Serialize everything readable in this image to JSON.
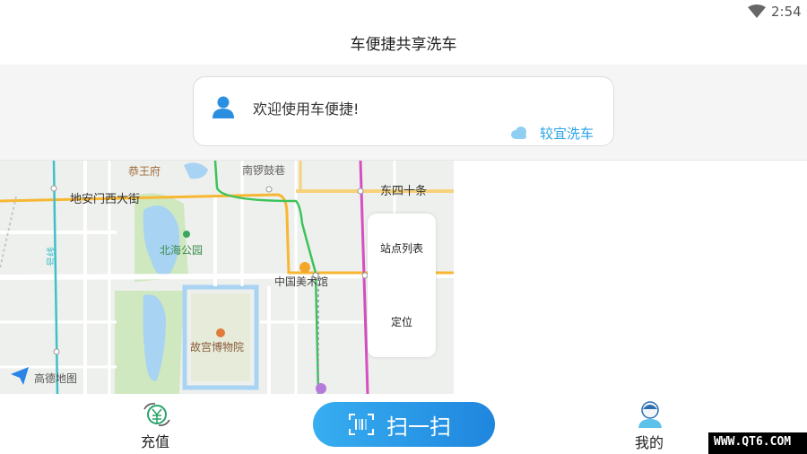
{
  "status_bar": {
    "time": "2:54",
    "wifi_icon": "wifi-icon"
  },
  "header": {
    "title": "车便捷共享洗车"
  },
  "welcome_card": {
    "greeting": "欢迎使用车便捷!",
    "weather_text": "较宜洗车",
    "user_icon": "user-icon",
    "weather_icon": "cloud-icon",
    "weather_color": "#2aa3e6"
  },
  "map": {
    "labels": {
      "road_north": "恭王府",
      "lane": "南锣鼓巷",
      "street_west": "地安门西大街",
      "street_east": "东四十条",
      "park": "北海公园",
      "gallery": "中国美术馆",
      "museum": "故宫博物院",
      "line_name": "号线"
    },
    "logo_text": "高德地图",
    "controls": {
      "station_list": "站点列表",
      "locate": "定位"
    }
  },
  "bottom_nav": {
    "recharge": {
      "label": "充值",
      "icon": "recharge-icon"
    },
    "scan": {
      "label": "扫一扫",
      "icon": "barcode-scan-icon"
    },
    "mine": {
      "label": "我的",
      "icon": "profile-icon"
    }
  },
  "watermark": {
    "text": "WWW.QT6.COM"
  },
  "colors": {
    "accent": "#2196e8",
    "scan_gradient_start": "#37aef0",
    "scan_gradient_end": "#1f86de"
  }
}
